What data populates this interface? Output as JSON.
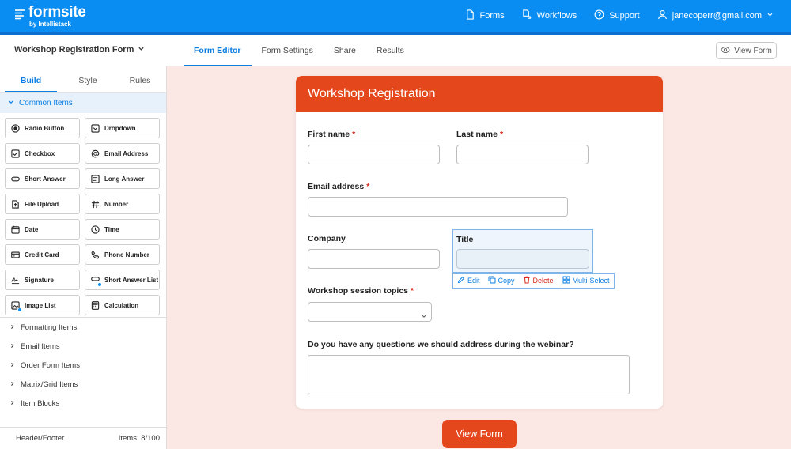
{
  "brand": {
    "name": "formsite",
    "tagline": "by Intellistack"
  },
  "topnav": {
    "forms": "Forms",
    "workflows": "Workflows",
    "support": "Support",
    "user_email": "janecoperr@gmail.com"
  },
  "subheader": {
    "form_name": "Workshop Registration Form",
    "tabs": [
      "Form Editor",
      "Form Settings",
      "Share",
      "Results"
    ],
    "active_tab": "Form Editor",
    "view_form": "View Form"
  },
  "sidebar": {
    "tabs": [
      "Build",
      "Style",
      "Rules"
    ],
    "active_tab": "Build",
    "common_section": "Common Items",
    "items": [
      {
        "label": "Radio Button",
        "icon": "radio-icon"
      },
      {
        "label": "Dropdown",
        "icon": "dropdown-icon"
      },
      {
        "label": "Checkbox",
        "icon": "checkbox-icon"
      },
      {
        "label": "Email Address",
        "icon": "at-icon"
      },
      {
        "label": "Short Answer",
        "icon": "short-answer-icon"
      },
      {
        "label": "Long Answer",
        "icon": "long-answer-icon"
      },
      {
        "label": "File Upload",
        "icon": "file-upload-icon"
      },
      {
        "label": "Number",
        "icon": "hash-icon"
      },
      {
        "label": "Date",
        "icon": "calendar-icon"
      },
      {
        "label": "Time",
        "icon": "clock-icon"
      },
      {
        "label": "Credit Card",
        "icon": "credit-card-icon"
      },
      {
        "label": "Phone Number",
        "icon": "phone-icon"
      },
      {
        "label": "Signature",
        "icon": "signature-icon"
      },
      {
        "label": "Short Answer List",
        "icon": "short-answer-list-icon"
      },
      {
        "label": "Image List",
        "icon": "image-list-icon"
      },
      {
        "label": "Calculation",
        "icon": "calculator-icon"
      }
    ],
    "groups": [
      "Formatting Items",
      "Email Items",
      "Order Form Items",
      "Matrix/Grid Items",
      "Item Blocks"
    ],
    "footer_left": "Header/Footer",
    "footer_right": "Items: 8/100"
  },
  "form": {
    "title": "Workshop Registration",
    "first_name": "First name",
    "last_name": "Last name",
    "email": "Email address",
    "company": "Company",
    "title_field": "Title",
    "session_topics": "Workshop session topics",
    "questions": "Do you have any questions we should address during the webinar?",
    "required_mark": "*",
    "actions": {
      "edit": "Edit",
      "copy": "Copy",
      "delete": "Delete",
      "multi_select": "Multi-Select"
    },
    "view_form_button": "View Form"
  },
  "colors": {
    "topbar": "#0a8df2",
    "accent_blue": "#0a7ee3",
    "form_header": "#e5471c",
    "canvas_bg": "#fbe7e3",
    "required": "#d9261c"
  }
}
